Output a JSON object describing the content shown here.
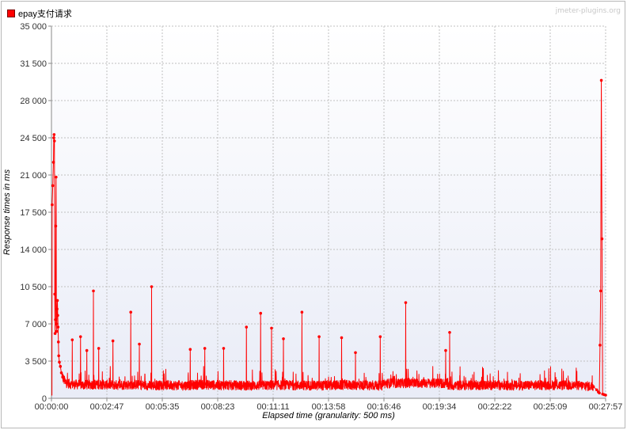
{
  "legend": {
    "label": "epay支付请求",
    "color": "#ff0000"
  },
  "watermark": "jmeter-plugins.org",
  "chart_data": {
    "type": "line",
    "xlabel": "Elapsed time (granularity: 500 ms)",
    "ylabel": "Response times in ms",
    "x_ticks": [
      "00:00:00",
      "00:02:47",
      "00:05:35",
      "00:08:23",
      "00:11:11",
      "00:13:58",
      "00:16:46",
      "00:19:34",
      "00:22:22",
      "00:25:09",
      "00:27:57"
    ],
    "y_ticks": [
      "0",
      "3 500",
      "7 000",
      "10 500",
      "14 000",
      "17 500",
      "21 000",
      "24 500",
      "28 000",
      "31 500",
      "35 000"
    ],
    "xlim_seconds": [
      0,
      1677
    ],
    "ylim": [
      0,
      35000
    ],
    "grid": true,
    "series": [
      {
        "name": "epay支付请求",
        "color": "#ff0000",
        "baseline_ms": 1300,
        "points_seconds_ms": [
          [
            2,
            18200
          ],
          [
            4,
            20000
          ],
          [
            6,
            22200
          ],
          [
            7,
            24500
          ],
          [
            8,
            24800
          ],
          [
            9,
            24200
          ],
          [
            10,
            9800
          ],
          [
            11,
            6100
          ],
          [
            12,
            7400
          ],
          [
            13,
            16200
          ],
          [
            14,
            20800
          ],
          [
            15,
            7000
          ],
          [
            16,
            6300
          ],
          [
            17,
            8400
          ],
          [
            18,
            9200
          ],
          [
            19,
            7800
          ],
          [
            20,
            6700
          ],
          [
            21,
            5300
          ],
          [
            22,
            4000
          ],
          [
            24,
            3400
          ],
          [
            27,
            3000
          ],
          [
            30,
            2400
          ],
          [
            34,
            2000
          ],
          [
            38,
            1700
          ],
          [
            45,
            1450
          ],
          [
            55,
            1350
          ],
          [
            65,
            1300
          ],
          [
            80,
            1300
          ],
          [
            100,
            1250
          ],
          [
            120,
            1300
          ],
          [
            150,
            1300
          ],
          [
            200,
            1250
          ],
          [
            250,
            1300
          ],
          [
            300,
            1200
          ],
          [
            350,
            1250
          ],
          [
            400,
            1200
          ],
          [
            450,
            1300
          ],
          [
            500,
            1250
          ],
          [
            600,
            1200
          ],
          [
            700,
            1250
          ],
          [
            800,
            1200
          ],
          [
            900,
            1250
          ],
          [
            1000,
            1200
          ],
          [
            1100,
            1250
          ],
          [
            1200,
            1200
          ],
          [
            1300,
            1250
          ],
          [
            1400,
            1200
          ],
          [
            1500,
            1250
          ],
          [
            1600,
            1200
          ],
          [
            1640,
            1100
          ],
          [
            1650,
            800
          ],
          [
            1655,
            600
          ],
          [
            1658,
            500
          ],
          [
            1660,
            5000
          ],
          [
            1662,
            10100
          ],
          [
            1664,
            29900
          ],
          [
            1666,
            15000
          ],
          [
            1668,
            400
          ],
          [
            1672,
            350
          ],
          [
            1677,
            300
          ]
        ],
        "spikes_seconds_ms": [
          [
            63,
            5500
          ],
          [
            88,
            5800
          ],
          [
            107,
            4500
          ],
          [
            127,
            10100
          ],
          [
            143,
            4700
          ],
          [
            186,
            5400
          ],
          [
            240,
            8100
          ],
          [
            266,
            5100
          ],
          [
            303,
            10500
          ],
          [
            420,
            4600
          ],
          [
            464,
            4700
          ],
          [
            521,
            4700
          ],
          [
            590,
            6700
          ],
          [
            633,
            8000
          ],
          [
            666,
            6600
          ],
          [
            702,
            5600
          ],
          [
            758,
            8100
          ],
          [
            810,
            5800
          ],
          [
            878,
            5700
          ],
          [
            920,
            4300
          ],
          [
            995,
            5800
          ],
          [
            1072,
            9000
          ],
          [
            1193,
            4500
          ],
          [
            1205,
            6200
          ]
        ]
      }
    ]
  }
}
